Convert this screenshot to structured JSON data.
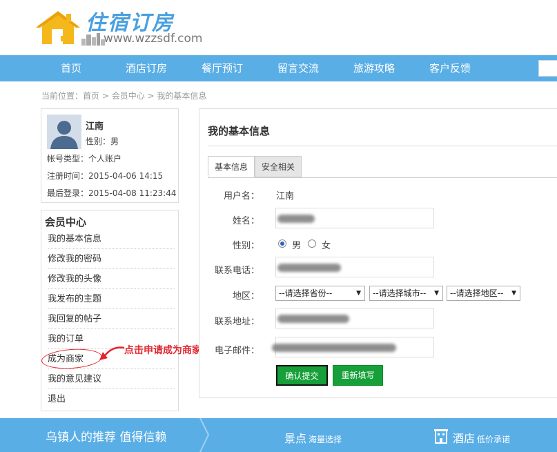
{
  "header": {
    "logo_cn": "住宿订房",
    "logo_url": "www.wzzsdf.com"
  },
  "nav": {
    "items": [
      "首页",
      "酒店订房",
      "餐厅预订",
      "留言交流",
      "旅游攻略",
      "客户反馈"
    ]
  },
  "breadcrumb": {
    "prefix": "当前位置：",
    "home": "首页",
    "sep1": " > ",
    "member": "会员中心",
    "sep2": " > ",
    "current": "我的基本信息"
  },
  "profile": {
    "name": "江南",
    "gender_label": "性别：",
    "gender": "男",
    "account_type_label": "帐号类型：",
    "account_type": "个人账户",
    "reg_label": "注册时间：",
    "reg_time": "2015-04-06 14:15",
    "last_login_label": "最后登录：",
    "last_login": "2015-04-08 11:23:44"
  },
  "menu": {
    "title": "会员中心",
    "items": [
      "我的基本信息",
      "修改我的密码",
      "修改我的头像",
      "我发布的主题",
      "我回复的帖子",
      "我的订单",
      "成为商家",
      "我的意见建议",
      "退出"
    ]
  },
  "annotation": {
    "text": "点击申请成为商家",
    "color": "#e0252e"
  },
  "panel": {
    "title": "我的基本信息",
    "tabs": [
      "基本信息",
      "安全相关"
    ],
    "active_tab": "基本信息"
  },
  "form": {
    "username_label": "用户名：",
    "username": "江南",
    "name_label": "姓名：",
    "gender_label": "性别：",
    "gender_options": [
      "男",
      "女"
    ],
    "gender_selected": "男",
    "phone_label": "联系电话：",
    "region_label": "地区：",
    "province_select": "--请选择省份--",
    "city_select": "--请选择城市--",
    "district_select": "--请选择地区--",
    "address_label": "联系地址：",
    "email_label": "电子邮件：",
    "submit": "确认提交",
    "reset": "重新填写"
  },
  "footer": {
    "slogan": "乌镇人的推荐  值得信赖",
    "spots": "景点",
    "spots_sub": "海量选择",
    "hotel": "酒店",
    "hotel_sub": "低价承诺"
  },
  "colors": {
    "nav_bg": "#5aaee6",
    "button_green": "#17a039",
    "annotation_red": "#e0252e",
    "logo_yellow": "#f5b81c"
  }
}
